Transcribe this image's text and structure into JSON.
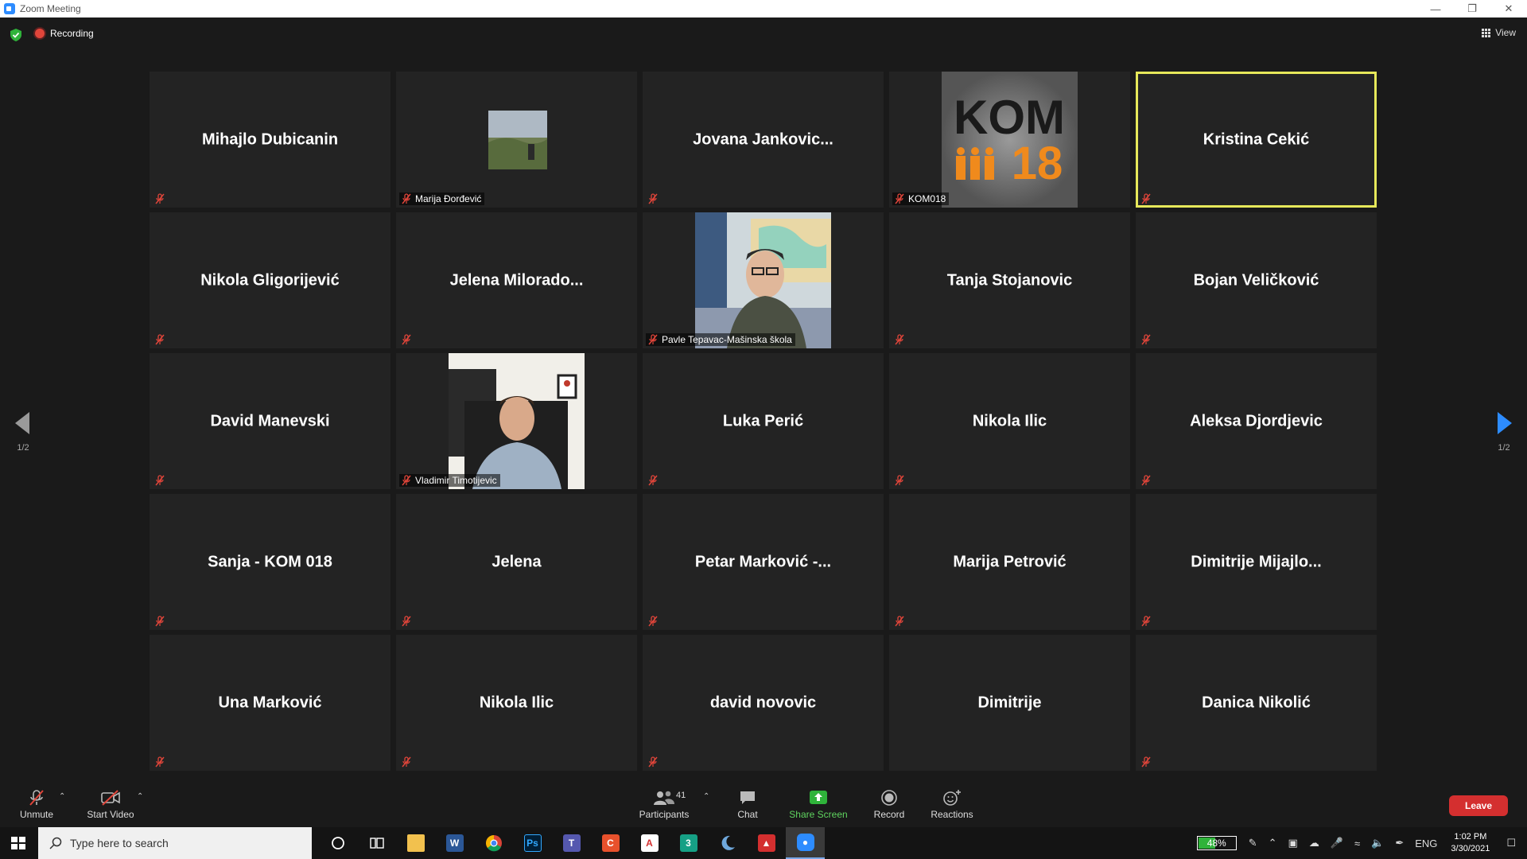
{
  "window": {
    "title": "Zoom Meeting"
  },
  "topbar": {
    "recording_label": "Recording",
    "view_label": "View"
  },
  "gallery": {
    "tiles": [
      {
        "name": "Mihajlo Dubicanin",
        "label": "",
        "kind": "name"
      },
      {
        "name": "",
        "label": "Marija Đorđević",
        "kind": "thumb"
      },
      {
        "name": "Jovana  Jankovic...",
        "label": "",
        "kind": "name"
      },
      {
        "name": "",
        "label": "KOM018",
        "kind": "logo"
      },
      {
        "name": "Kristina Cekić",
        "label": "",
        "kind": "name",
        "active": true
      },
      {
        "name": "Nikola Gligorijević",
        "label": "",
        "kind": "name"
      },
      {
        "name": "Jelena  Milorado...",
        "label": "",
        "kind": "name"
      },
      {
        "name": "",
        "label": "Pavle Tepavac-Mašinska škola",
        "kind": "video"
      },
      {
        "name": "Tanja Stojanovic",
        "label": "",
        "kind": "name"
      },
      {
        "name": "Bojan Veličković",
        "label": "",
        "kind": "name"
      },
      {
        "name": "David Manevski",
        "label": "",
        "kind": "name"
      },
      {
        "name": "",
        "label": "Vladimir Timotijevic",
        "kind": "video2"
      },
      {
        "name": "Luka Perić",
        "label": "",
        "kind": "name"
      },
      {
        "name": "Nikola Ilic",
        "label": "",
        "kind": "name"
      },
      {
        "name": "Aleksa Djordjevic",
        "label": "",
        "kind": "name"
      },
      {
        "name": "Sanja - KOM 018",
        "label": "",
        "kind": "name"
      },
      {
        "name": "Jelena",
        "label": "",
        "kind": "name"
      },
      {
        "name": "Petar  Marković -...",
        "label": "",
        "kind": "name"
      },
      {
        "name": "Marija Petrović",
        "label": "",
        "kind": "name"
      },
      {
        "name": "Dimitrije  Mijajlo...",
        "label": "",
        "kind": "name"
      },
      {
        "name": "Una Marković",
        "label": "",
        "kind": "name"
      },
      {
        "name": "Nikola Ilic",
        "label": "",
        "kind": "name"
      },
      {
        "name": "david novovic",
        "label": "",
        "kind": "name"
      },
      {
        "name": "Dimitrije",
        "label": "",
        "kind": "name",
        "unmuted": true
      },
      {
        "name": "Danica Nikolić",
        "label": "",
        "kind": "name"
      }
    ],
    "logo": {
      "top": "KOM",
      "bottom": "18"
    }
  },
  "pagination": {
    "left": "1/2",
    "right": "1/2"
  },
  "toolbar": {
    "unmute": "Unmute",
    "start_video": "Start Video",
    "participants": "Participants",
    "participants_count": "41",
    "chat": "Chat",
    "share_screen": "Share Screen",
    "record": "Record",
    "reactions": "Reactions",
    "leave": "Leave"
  },
  "taskbar": {
    "search_placeholder": "Type here to search",
    "battery": "48%",
    "battery_level": 0.48,
    "language": "ENG",
    "time": "1:02 PM",
    "date": "3/30/2021"
  },
  "colors": {
    "accent_green": "#5fd45f",
    "leave_red": "#d42f2f",
    "active_border": "#e6e85a",
    "mute_red": "#e0453a"
  }
}
